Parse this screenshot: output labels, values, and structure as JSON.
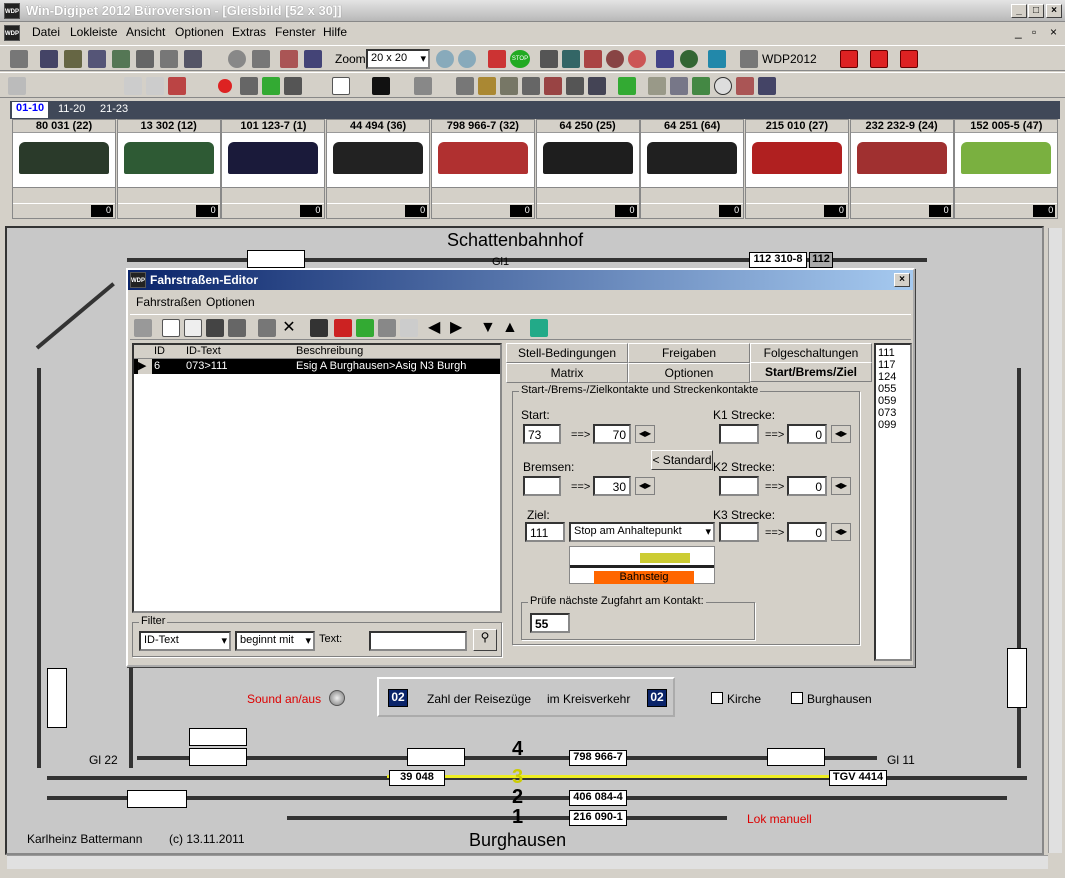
{
  "app": {
    "title": "Win-Digipet 2012 Büroversion - [Gleisbild [52 x 30]]",
    "logo": "WDP"
  },
  "menu": [
    "Datei",
    "Lokleiste",
    "Ansicht",
    "Optionen",
    "Extras",
    "Fenster",
    "Hilfe"
  ],
  "toolbar": {
    "zoom_label": "Zoom",
    "zoom_value": "20 x 20",
    "wdp_label": "WDP2012",
    "stop_label": "STOP"
  },
  "loco_tabs": [
    "01-10",
    "11-20",
    "21-23"
  ],
  "locos": [
    {
      "name": "80 031 (22)",
      "color": "#2a3a2a",
      "val": "0"
    },
    {
      "name": "13 302 (12)",
      "color": "#2e5a34",
      "val": "0"
    },
    {
      "name": "101 123-7 (1)",
      "color": "#1a1a3a",
      "val": "0"
    },
    {
      "name": "44 494 (36)",
      "color": "#222",
      "val": "0"
    },
    {
      "name": "798 966-7 (32)",
      "color": "#b03030",
      "val": "0"
    },
    {
      "name": "64 250 (25)",
      "color": "#1e1e1e",
      "val": "0"
    },
    {
      "name": "64 251 (64)",
      "color": "#202020",
      "val": "0"
    },
    {
      "name": "215 010 (27)",
      "color": "#b02020",
      "val": "0"
    },
    {
      "name": "232 232-9 (24)",
      "color": "#a03030",
      "val": "0"
    },
    {
      "name": "152 005-5 (47)",
      "color": "#7ab040",
      "val": "0"
    }
  ],
  "plan": {
    "top_title": "Schattenbahnhof",
    "bottom_title": "Burghausen",
    "author": "Karlheinz Battermann",
    "date": "(c) 13.11.2011",
    "sound": "Sound an/aus",
    "lok_manuell": "Lok manuell",
    "count_a": "02",
    "count_b": "02",
    "count_text_1": "Zahl der Reisezüge",
    "count_text_2": "im Kreisverkehr",
    "kirche": "Kirche",
    "burghausen_btn": "Burghausen",
    "gl1": "Gl1",
    "gl22": "Gl 22",
    "gl11": "Gl 11",
    "box_top": "112 310-8",
    "box_top2": "112",
    "train_a": "39 048",
    "train_b": "798 966-7",
    "train_c": "TGV 4414",
    "train_d": "406 084-4",
    "train_e": "216 090-1",
    "track_nums": [
      "4",
      "3",
      "2",
      "1"
    ]
  },
  "dialog": {
    "title": "Fahrstraßen-Editor",
    "menu": [
      "Fahrstraßen",
      "Optionen"
    ],
    "grid_headers": [
      "ID",
      "ID-Text",
      "Beschreibung"
    ],
    "grid_row": {
      "id": "6",
      "text": "073>111",
      "desc": "Esig A Burghausen>Asig N3 Burgha"
    },
    "filter": {
      "label": "Filter",
      "field": "ID-Text",
      "mode": "beginnt mit",
      "text_label": "Text:",
      "text_value": ""
    },
    "tabs_row1": [
      "Stell-Bedingungen",
      "Freigaben",
      "Folgeschaltungen"
    ],
    "tabs_row2": [
      "Matrix",
      "Optionen",
      "Start/Brems/Ziel"
    ],
    "group_title": "Start-/Brems-/Zielkontakte und Streckenkontakte",
    "start_label": "Start:",
    "start_val": "73",
    "start_to": "70",
    "brems_label": "Bremsen:",
    "brems_val": "",
    "brems_to": "30",
    "ziel_label": "Ziel:",
    "ziel_val": "111",
    "ziel_mode": "Stop am Anhaltepunkt",
    "standard_btn": "< Standard",
    "k1": "K1 Strecke:",
    "k2": "K2 Strecke:",
    "k3": "K3 Strecke:",
    "k1_to": "0",
    "k2_to": "0",
    "k3_to": "0",
    "arrow": "==>",
    "bahnsteig": "Bahnsteig",
    "pruefe_label": "Prüfe nächste Zugfahrt am Kontakt:",
    "pruefe_val": "55",
    "list": [
      "111",
      "117",
      "124",
      "055",
      "059",
      "073",
      "099"
    ]
  }
}
